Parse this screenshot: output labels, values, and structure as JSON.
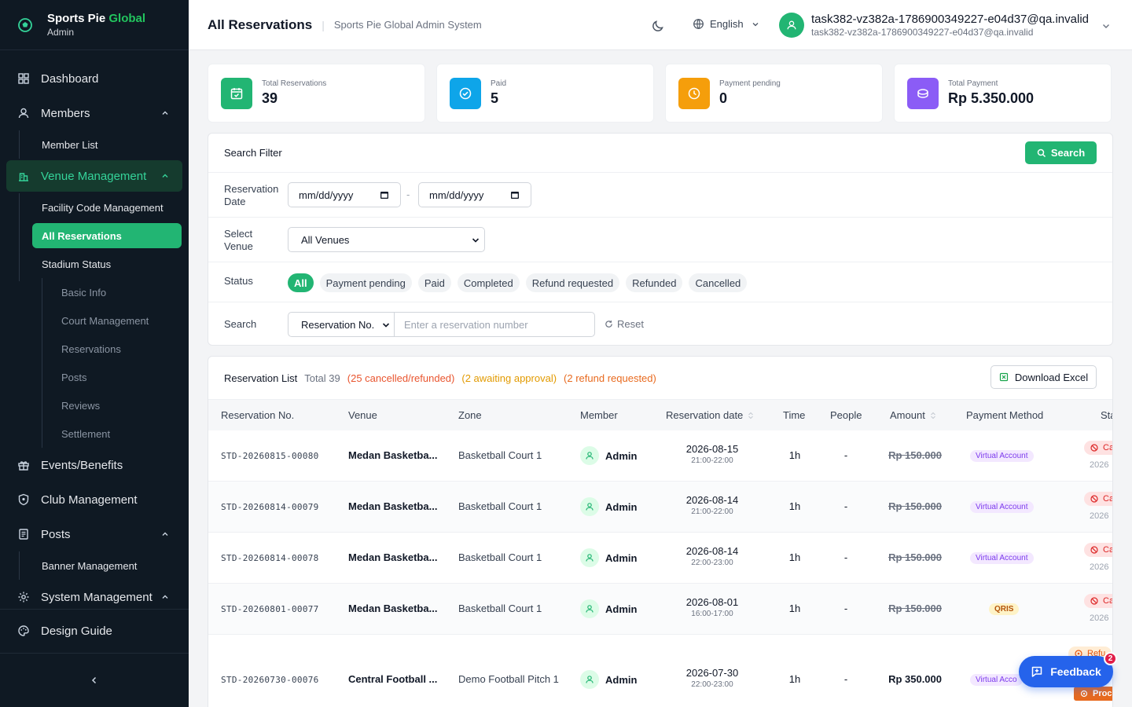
{
  "brand": {
    "name_a": "Sports Pie ",
    "name_b": "Global",
    "role": "Admin"
  },
  "sidebar": {
    "items": [
      {
        "label": "Dashboard"
      },
      {
        "label": "Members",
        "children": [
          "Member List"
        ]
      },
      {
        "label": "Venue Management",
        "children": [
          "Facility Code Management",
          "All Reservations",
          "Stadium Status"
        ],
        "grandchildren": [
          "Basic Info",
          "Court Management",
          "Reservations",
          "Posts",
          "Reviews",
          "Settlement"
        ]
      },
      {
        "label": "Events/Benefits"
      },
      {
        "label": "Club Management"
      },
      {
        "label": "Posts",
        "children": [
          "Banner Management"
        ]
      },
      {
        "label": "System Management"
      },
      {
        "label": "Design Guide"
      }
    ]
  },
  "header": {
    "title": "All Reservations",
    "subtitle": "Sports Pie Global Admin System",
    "language": "English",
    "user_name": "task382-vz382a-1786900349227-e04d37@qa.invalid",
    "user_email": "task382-vz382a-1786900349227-e04d37@qa.invalid"
  },
  "stats": [
    {
      "label": "Total Reservations",
      "value": "39",
      "color": "#22b573",
      "icon": "calendar-icon"
    },
    {
      "label": "Paid",
      "value": "5",
      "color": "#0ea5e9",
      "icon": "check-circle-icon"
    },
    {
      "label": "Payment pending",
      "value": "0",
      "color": "#f59e0b",
      "icon": "clock-icon"
    },
    {
      "label": "Total Payment",
      "value": "Rp 5.350.000",
      "color": "#8b5cf6",
      "icon": "coins-icon"
    }
  ],
  "filter": {
    "title": "Search Filter",
    "search_button": "Search",
    "date_label": "Reservation Date",
    "date_from": "mm/dd/yyyy",
    "date_to": "mm/dd/yyyy",
    "date_sep": "-",
    "venue_label": "Select Venue",
    "venue_value": "All Venues",
    "status_label": "Status",
    "status_chips": [
      "All",
      "Payment pending",
      "Paid",
      "Completed",
      "Refund requested",
      "Refunded",
      "Cancelled"
    ],
    "search_label": "Search",
    "search_type": "Reservation No.",
    "search_placeholder": "Enter a reservation number",
    "reset": "Reset"
  },
  "list": {
    "title": "Reservation List",
    "total": "Total 39",
    "cancelled": "(25 cancelled/refunded)",
    "awaiting": "(2 awaiting approval)",
    "refund_req": "(2 refund requested)",
    "excel": "Download Excel",
    "columns": [
      "Reservation No.",
      "Venue",
      "Zone",
      "Member",
      "Reservation date",
      "Time",
      "People",
      "Amount",
      "Payment Method",
      "Sta"
    ],
    "rows": [
      {
        "no": "STD-20260815-00080",
        "venue": "Medan Basketba...",
        "zone": "Basketball Court 1",
        "member": "Admin",
        "date": "2026-08-15",
        "slot": "21:00-22:00",
        "time": "1h",
        "people": "-",
        "amount": "Rp 150.000",
        "method": "Virtual Account",
        "status": "Ca",
        "status_sub": "2026"
      },
      {
        "no": "STD-20260814-00079",
        "venue": "Medan Basketba...",
        "zone": "Basketball Court 1",
        "member": "Admin",
        "date": "2026-08-14",
        "slot": "21:00-22:00",
        "time": "1h",
        "people": "-",
        "amount": "Rp 150.000",
        "method": "Virtual Account",
        "status": "Ca",
        "status_sub": "2026"
      },
      {
        "no": "STD-20260814-00078",
        "venue": "Medan Basketba...",
        "zone": "Basketball Court 1",
        "member": "Admin",
        "date": "2026-08-14",
        "slot": "22:00-23:00",
        "time": "1h",
        "people": "-",
        "amount": "Rp 150.000",
        "method": "Virtual Account",
        "status": "Ca",
        "status_sub": "2026"
      },
      {
        "no": "STD-20260801-00077",
        "venue": "Medan Basketba...",
        "zone": "Basketball Court 1",
        "member": "Admin",
        "date": "2026-08-01",
        "slot": "16:00-17:00",
        "time": "1h",
        "people": "-",
        "amount": "Rp 150.000",
        "method": "QRIS",
        "status": "Ca",
        "status_sub": "2026"
      },
      {
        "no": "STD-20260730-00076",
        "venue": "Central Football ...",
        "zone": "Demo Football Pitch 1",
        "member": "Admin",
        "date": "2026-07-30",
        "slot": "22:00-23:00",
        "time": "1h",
        "people": "-",
        "amount": "Rp 350.000",
        "method": "Virtual Acco",
        "status": "Refu",
        "status_b": "Proce"
      }
    ]
  },
  "feedback": {
    "label": "Feedback",
    "badge": "2"
  }
}
